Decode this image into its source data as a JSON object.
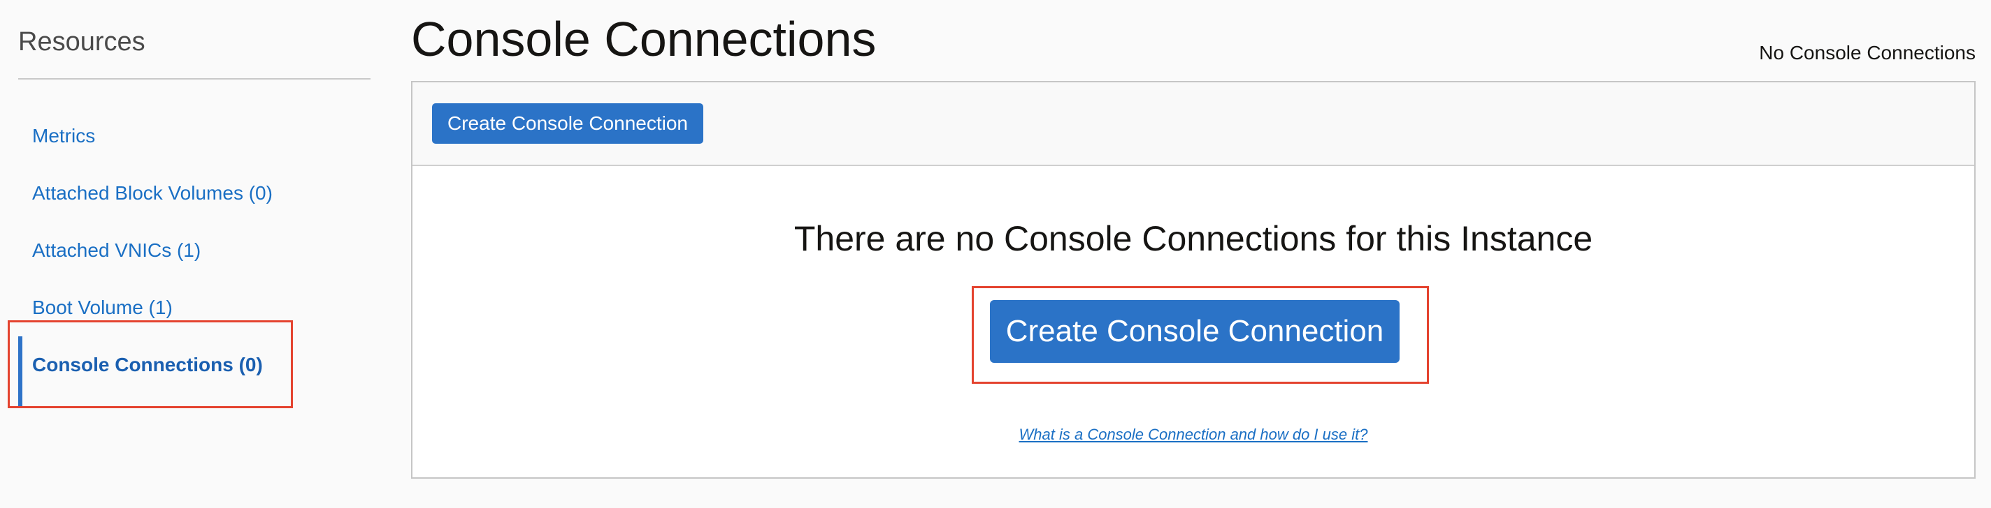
{
  "sidebar": {
    "title": "Resources",
    "items": [
      {
        "label": "Metrics"
      },
      {
        "label": "Attached Block Volumes (0)"
      },
      {
        "label": "Attached VNICs (1)"
      },
      {
        "label": "Boot Volume (1)"
      },
      {
        "label": "Console Connections (0)"
      }
    ]
  },
  "main": {
    "title": "Console Connections",
    "count_text": "No Console Connections",
    "toolbar": {
      "create_label": "Create Console Connection"
    },
    "empty_state": {
      "message": "There are no Console Connections for this Instance",
      "create_label": "Create Console Connection",
      "help_link": "What is a Console Connection and how do I use it?"
    }
  },
  "colors": {
    "accent": "#2b73c7",
    "link": "#1a6fc4",
    "highlight": "#e4432f"
  }
}
